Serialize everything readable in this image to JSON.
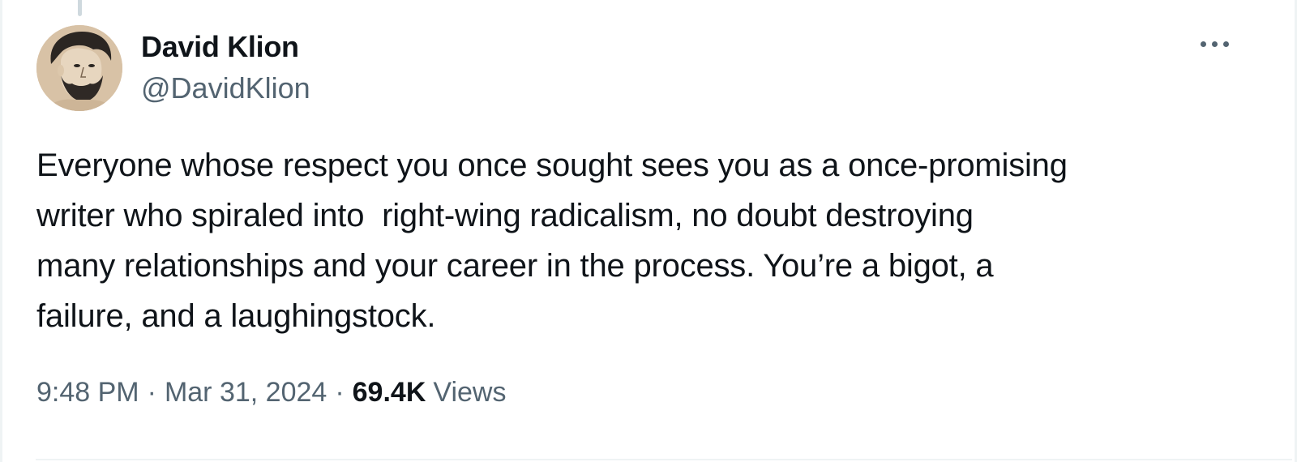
{
  "tweet": {
    "author": {
      "display_name": "David Klion",
      "handle": "@DavidKlion",
      "avatar_icon": "user-portrait-avatar"
    },
    "more_icon": "more-options-icon",
    "text_lines": [
      "Everyone whose respect you once sought sees you as a once-promising",
      "writer who spiraled into  right-wing radicalism, no doubt destroying",
      "many relationships and your career in the process. You’re a bigot, a",
      "failure, and a laughingstock."
    ],
    "meta": {
      "time": "9:48 PM",
      "separator": "·",
      "date": "Mar 31, 2024",
      "views_count": "69.4K",
      "views_label": "Views"
    }
  },
  "colors": {
    "primary_text": "#0f1419",
    "secondary_text": "#536471",
    "border": "#eff3f4",
    "thread_line": "#cfd9de"
  }
}
